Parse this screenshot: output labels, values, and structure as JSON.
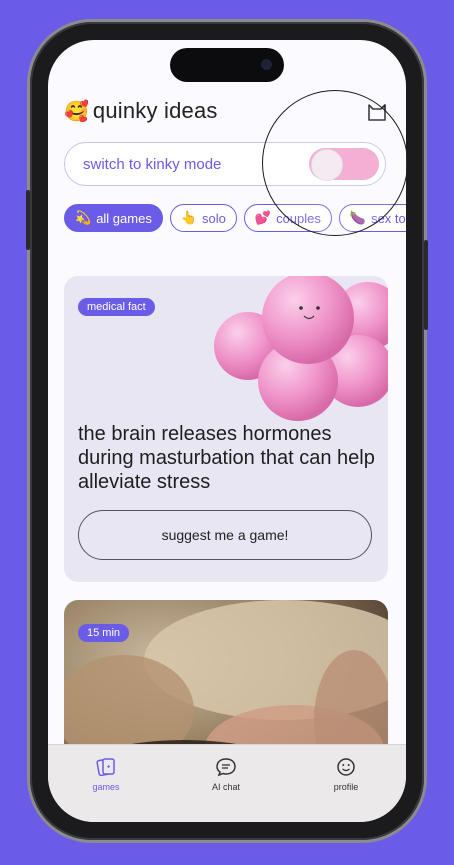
{
  "app": {
    "logo_emoji": "🥰",
    "title": "quinky ideas"
  },
  "mode_toggle": {
    "label": "switch to kinky mode"
  },
  "filters": [
    {
      "emoji": "💫",
      "label": "all games",
      "active": true
    },
    {
      "emoji": "👆",
      "label": "solo",
      "active": false
    },
    {
      "emoji": "💕",
      "label": "couples",
      "active": false
    },
    {
      "emoji": "🍆",
      "label": "sex toys",
      "active": false
    }
  ],
  "fact_card": {
    "badge": "medical fact",
    "text": "the brain releases hormones during masturbation that can help alleviate stress",
    "button": "suggest me a game!"
  },
  "game_card": {
    "badge": "15 min"
  },
  "tabs": [
    {
      "label": "games",
      "icon": "cards-icon"
    },
    {
      "label": "AI chat",
      "icon": "chat-bubble-icon"
    },
    {
      "label": "profile",
      "icon": "smiley-icon"
    }
  ],
  "colors": {
    "background": "#6b5ce7",
    "accent": "#6b5ce7",
    "toggle_on": "#f2a6cf"
  }
}
